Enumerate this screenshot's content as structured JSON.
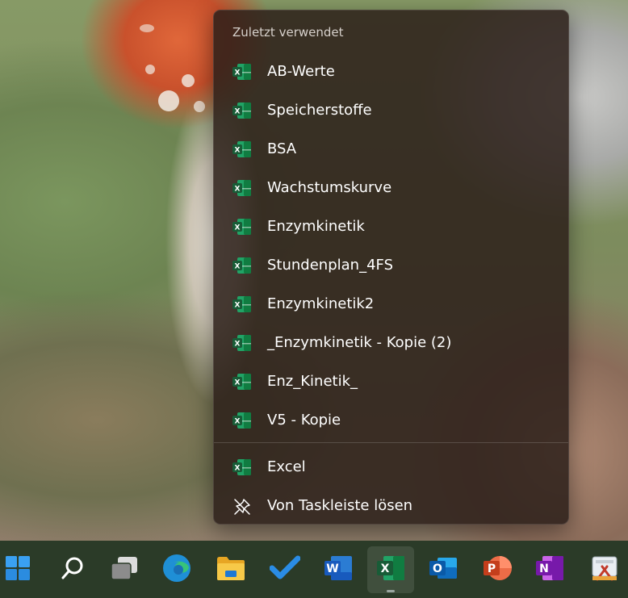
{
  "jumplist": {
    "header": "Zuletzt verwendet",
    "recent": [
      {
        "label": "AB-Werte"
      },
      {
        "label": "Speicherstoffe"
      },
      {
        "label": "BSA"
      },
      {
        "label": "Wachstumskurve"
      },
      {
        "label": "Enzymkinetik"
      },
      {
        "label": "Stundenplan_4FS"
      },
      {
        "label": "Enzymkinetik2"
      },
      {
        "label": "_Enzymkinetik - Kopie (2)"
      },
      {
        "label": "Enz_Kinetik_"
      },
      {
        "label": "V5 - Kopie"
      }
    ],
    "app_label": "Excel",
    "unpin_label": "Von Taskleiste lösen"
  },
  "taskbar": {
    "apps": [
      {
        "name": "start",
        "icon": "windows-logo-icon"
      },
      {
        "name": "search",
        "icon": "search-icon"
      },
      {
        "name": "task-view",
        "icon": "task-view-icon"
      },
      {
        "name": "edge",
        "icon": "edge-icon"
      },
      {
        "name": "file-explorer",
        "icon": "folder-icon"
      },
      {
        "name": "todo",
        "icon": "checkmark-icon"
      },
      {
        "name": "word",
        "icon": "word-icon",
        "letter": "W"
      },
      {
        "name": "excel",
        "icon": "excel-icon",
        "letter": "X",
        "active": true
      },
      {
        "name": "outlook",
        "icon": "outlook-icon",
        "letter": "O"
      },
      {
        "name": "powerpoint",
        "icon": "powerpoint-icon",
        "letter": "P"
      },
      {
        "name": "onenote",
        "icon": "onenote-icon",
        "letter": "N"
      },
      {
        "name": "snipping",
        "icon": "snipping-tool-icon"
      }
    ]
  },
  "colors": {
    "excel_green": "#1f7244",
    "menu_bg": "#2c201a",
    "taskbar_bg": "#2b3b28",
    "word_blue": "#185abd",
    "outlook_blue": "#0f6cbd",
    "powerpoint_red": "#c43e1c",
    "onenote_purple": "#7719aa"
  }
}
